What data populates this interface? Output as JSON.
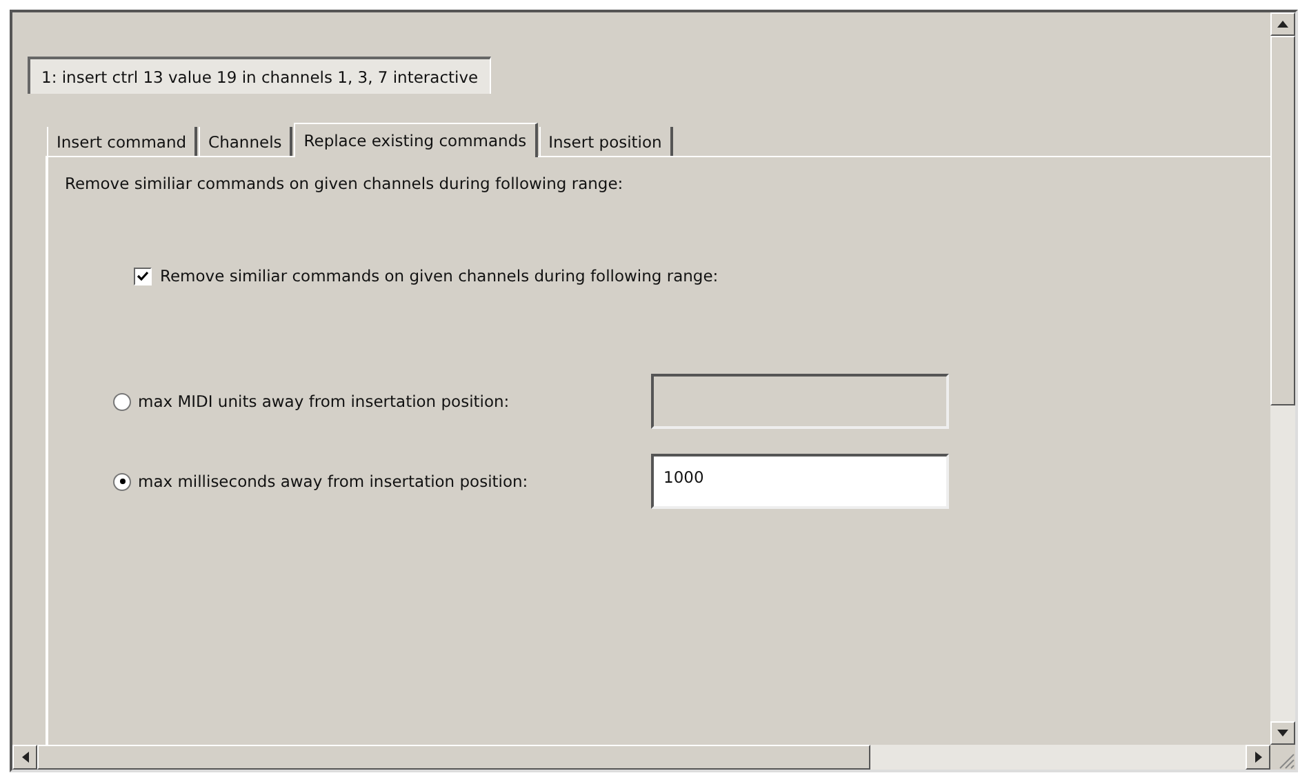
{
  "header": {
    "label": "1: insert ctrl 13 value 19 in channels 1, 3, 7 interactive"
  },
  "tabs": [
    {
      "label": "Insert command",
      "selected": false
    },
    {
      "label": "Channels",
      "selected": false
    },
    {
      "label": "Replace existing commands",
      "selected": true
    },
    {
      "label": "Insert position",
      "selected": false
    }
  ],
  "panel": {
    "description": "Remove similiar commands on given channels during following range:",
    "checkbox": {
      "label": "Remove similiar commands on given channels during following range:",
      "checked": true
    },
    "options": [
      {
        "label": "max MIDI units away from insertation position:",
        "selected": false,
        "disabled": true
      },
      {
        "label": "max milliseconds away from insertation position:",
        "selected": true,
        "value": "1000",
        "disabled": false
      }
    ]
  }
}
